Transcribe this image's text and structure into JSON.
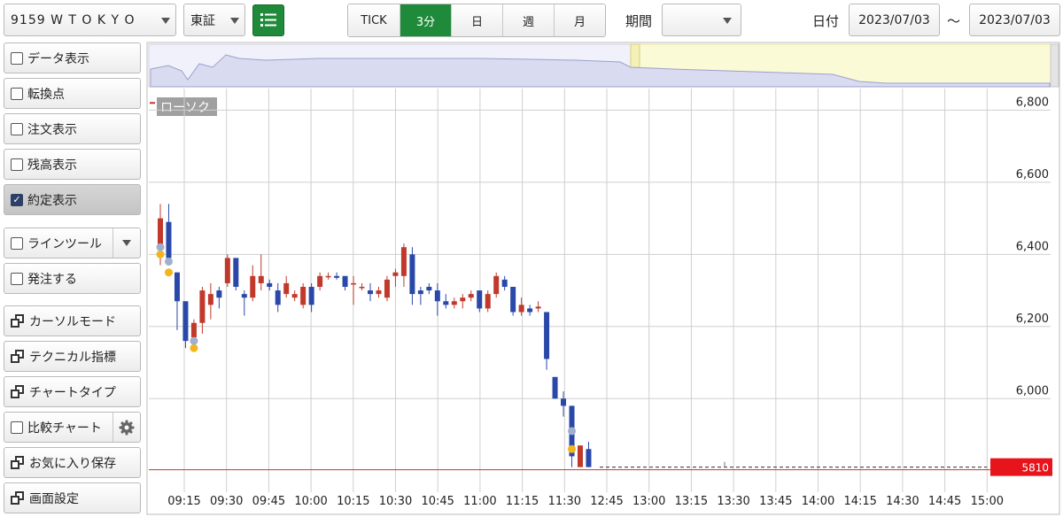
{
  "toolbar": {
    "symbol": "9159 W T O K Y O",
    "market": "東証",
    "periods": [
      "TICK",
      "3分",
      "日",
      "週",
      "月"
    ],
    "active_period": "3分",
    "period_label": "期間",
    "period_value": "",
    "date_label": "日付",
    "date_from": "2023/07/03",
    "date_sep": "～",
    "date_to": "2023/07/03",
    "accent": "#1f8a3a"
  },
  "sidebar": {
    "items": [
      {
        "label": "データ表示",
        "kind": "checkbox",
        "checked": false
      },
      {
        "label": "転換点",
        "kind": "checkbox",
        "checked": false
      },
      {
        "label": "注文表示",
        "kind": "checkbox",
        "checked": false
      },
      {
        "label": "残高表示",
        "kind": "checkbox",
        "checked": false
      },
      {
        "label": "約定表示",
        "kind": "checkbox",
        "checked": true
      },
      {
        "label": "ラインツール",
        "kind": "checkbox",
        "checked": false
      },
      {
        "label": "発注する",
        "kind": "checkbox",
        "checked": false
      },
      {
        "label": "カーソルモード",
        "kind": "window"
      },
      {
        "label": "テクニカル指標",
        "kind": "window"
      },
      {
        "label": "チャートタイプ",
        "kind": "window"
      },
      {
        "label": "比較チャート",
        "kind": "checkbox",
        "checked": false
      },
      {
        "label": "お気に入り保存",
        "kind": "window"
      },
      {
        "label": "画面設定",
        "kind": "window"
      }
    ]
  },
  "chart_data": {
    "type": "candlestick",
    "chart_label": "ローソク",
    "y_ticks": [
      "6,800",
      "6,600",
      "6,400",
      "6,200",
      "6,000"
    ],
    "x_ticks": [
      "09:15",
      "09:30",
      "09:45",
      "10:00",
      "10:15",
      "10:30",
      "10:45",
      "11:00",
      "11:15",
      "11:30",
      "12:45",
      "13:00",
      "13:15",
      "13:30",
      "13:45",
      "14:00",
      "14:15",
      "14:30",
      "14:45",
      "15:00"
    ],
    "ylim": [
      5760,
      6860
    ],
    "grid": true,
    "current_price": "5810",
    "up_color": "#c0392b",
    "down_color": "#2948a8",
    "candles": [
      {
        "o": 6420,
        "h": 6540,
        "l": 6370,
        "c": 6500
      },
      {
        "o": 6490,
        "h": 6540,
        "l": 6370,
        "c": 6390
      },
      {
        "o": 6350,
        "h": 6350,
        "l": 6190,
        "c": 6270
      },
      {
        "o": 6270,
        "h": 6270,
        "l": 6140,
        "c": 6160
      },
      {
        "o": 6170,
        "h": 6220,
        "l": 6140,
        "c": 6210
      },
      {
        "o": 6210,
        "h": 6310,
        "l": 6180,
        "c": 6300
      },
      {
        "o": 6260,
        "h": 6320,
        "l": 6220,
        "c": 6290
      },
      {
        "o": 6300,
        "h": 6310,
        "l": 6250,
        "c": 6280
      },
      {
        "o": 6320,
        "h": 6400,
        "l": 6310,
        "c": 6390
      },
      {
        "o": 6390,
        "h": 6390,
        "l": 6300,
        "c": 6310
      },
      {
        "o": 6290,
        "h": 6300,
        "l": 6230,
        "c": 6280
      },
      {
        "o": 6280,
        "h": 6370,
        "l": 6270,
        "c": 6340
      },
      {
        "o": 6320,
        "h": 6400,
        "l": 6300,
        "c": 6340
      },
      {
        "o": 6320,
        "h": 6330,
        "l": 6300,
        "c": 6310
      },
      {
        "o": 6300,
        "h": 6320,
        "l": 6240,
        "c": 6260
      },
      {
        "o": 6290,
        "h": 6340,
        "l": 6280,
        "c": 6320
      },
      {
        "o": 6280,
        "h": 6300,
        "l": 6270,
        "c": 6290
      },
      {
        "o": 6260,
        "h": 6320,
        "l": 6250,
        "c": 6310
      },
      {
        "o": 6310,
        "h": 6320,
        "l": 6240,
        "c": 6260
      },
      {
        "o": 6310,
        "h": 6350,
        "l": 6300,
        "c": 6340
      },
      {
        "o": 6340,
        "h": 6350,
        "l": 6330,
        "c": 6340
      },
      {
        "o": 6340,
        "h": 6350,
        "l": 6330,
        "c": 6335
      },
      {
        "o": 6340,
        "h": 6340,
        "l": 6300,
        "c": 6310
      },
      {
        "o": 6320,
        "h": 6340,
        "l": 6260,
        "c": 6320
      },
      {
        "o": 6310,
        "h": 6320,
        "l": 6300,
        "c": 6310
      },
      {
        "o": 6300,
        "h": 6320,
        "l": 6270,
        "c": 6290
      },
      {
        "o": 6290,
        "h": 6310,
        "l": 6280,
        "c": 6300
      },
      {
        "o": 6280,
        "h": 6340,
        "l": 6270,
        "c": 6330
      },
      {
        "o": 6340,
        "h": 6360,
        "l": 6310,
        "c": 6350
      },
      {
        "o": 6340,
        "h": 6430,
        "l": 6310,
        "c": 6420
      },
      {
        "o": 6400,
        "h": 6420,
        "l": 6260,
        "c": 6290
      },
      {
        "o": 6300,
        "h": 6310,
        "l": 6260,
        "c": 6290
      },
      {
        "o": 6310,
        "h": 6320,
        "l": 6290,
        "c": 6300
      },
      {
        "o": 6300,
        "h": 6320,
        "l": 6230,
        "c": 6270
      },
      {
        "o": 6270,
        "h": 6290,
        "l": 6250,
        "c": 6260
      },
      {
        "o": 6260,
        "h": 6280,
        "l": 6250,
        "c": 6270
      },
      {
        "o": 6270,
        "h": 6290,
        "l": 6250,
        "c": 6280
      },
      {
        "o": 6280,
        "h": 6300,
        "l": 6270,
        "c": 6290
      },
      {
        "o": 6300,
        "h": 6300,
        "l": 6240,
        "c": 6250
      },
      {
        "o": 6250,
        "h": 6300,
        "l": 6240,
        "c": 6290
      },
      {
        "o": 6290,
        "h": 6350,
        "l": 6280,
        "c": 6340
      },
      {
        "o": 6330,
        "h": 6340,
        "l": 6300,
        "c": 6310
      },
      {
        "o": 6310,
        "h": 6310,
        "l": 6230,
        "c": 6240
      },
      {
        "o": 6240,
        "h": 6280,
        "l": 6230,
        "c": 6260
      },
      {
        "o": 6250,
        "h": 6260,
        "l": 6230,
        "c": 6240
      },
      {
        "o": 6250,
        "h": 6270,
        "l": 6240,
        "c": 6255
      },
      {
        "o": 6240,
        "h": 6240,
        "l": 6080,
        "c": 6110
      },
      {
        "o": 6060,
        "h": 6060,
        "l": 6000,
        "c": 6000
      },
      {
        "o": 6000,
        "h": 6020,
        "l": 5950,
        "c": 5980
      },
      {
        "o": 5980,
        "h": 5980,
        "l": 5810,
        "c": 5840
      },
      {
        "o": 5810,
        "h": 5870,
        "l": 5810,
        "c": 5870
      },
      {
        "o": 5860,
        "h": 5880,
        "l": 5810,
        "c": 5810
      }
    ],
    "afternoon": [
      {
        "time": "12:45",
        "value": 5810
      },
      {
        "time": "15:00",
        "value": 5810
      }
    ],
    "executions": [
      {
        "candle": 0,
        "price": 6400,
        "side": "buy"
      },
      {
        "candle": 0,
        "price": 6420,
        "side": "sell"
      },
      {
        "candle": 1,
        "price": 6350,
        "side": "buy"
      },
      {
        "candle": 1,
        "price": 6380,
        "side": "sell"
      },
      {
        "candle": 4,
        "price": 6140,
        "side": "buy"
      },
      {
        "candle": 4,
        "price": 6160,
        "side": "sell"
      },
      {
        "candle": 49,
        "price": 5860,
        "side": "buy"
      },
      {
        "candle": 49,
        "price": 5910,
        "side": "sell"
      }
    ]
  }
}
